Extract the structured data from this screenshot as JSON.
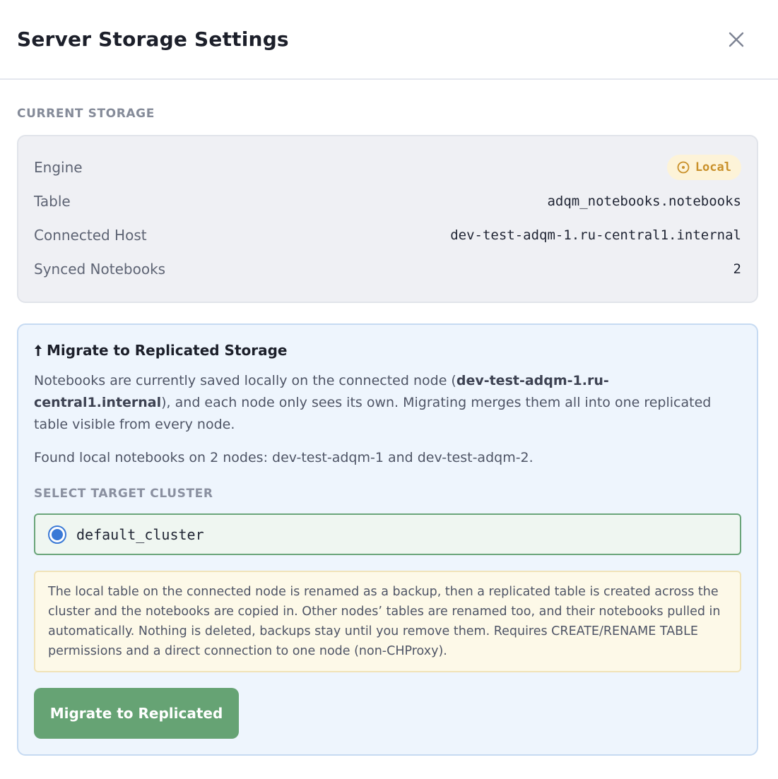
{
  "dialog": {
    "title": "Server Storage Settings",
    "close_icon": "close-icon"
  },
  "current_storage": {
    "label": "CURRENT STORAGE",
    "rows": [
      {
        "label": "Engine",
        "value": "Local",
        "type": "badge",
        "badge_icon": "clock-icon",
        "badge_color": "#c9902a"
      },
      {
        "label": "Table",
        "value": "adqm_notebooks.notebooks"
      },
      {
        "label": "Connected Host",
        "value": "dev-test-adqm-1.ru-central1.internal"
      },
      {
        "label": "Synced Notebooks",
        "value": "2"
      }
    ]
  },
  "migrate": {
    "title_icon": "arrow-up-icon",
    "title": "Migrate to Replicated Storage",
    "description_pre": "Notebooks are currently saved locally on the connected node (",
    "description_host": "dev-test-adqm-1.ru-central1.internal",
    "description_post": "), and each node only sees its own. Migrating merges them all into one replicated table visible from every node.",
    "found": "Found local notebooks on 2 nodes: dev-test-adqm-1 and dev-test-adqm-2.",
    "select_label": "SELECT TARGET CLUSTER",
    "cluster": {
      "name": "default_cluster",
      "selected": true
    },
    "warning": "The local table on the connected node is renamed as a backup, then a replicated table is created across the cluster and the notebooks are copied in. Other nodes’ tables are renamed too, and their notebooks pulled in automatically. Nothing is deleted, backups stay until you remove them. Requires CREATE/RENAME TABLE permissions and a direct connection to one node (non-CHProxy).",
    "button_label": "Migrate to Replicated",
    "button_color": "#66a374"
  }
}
